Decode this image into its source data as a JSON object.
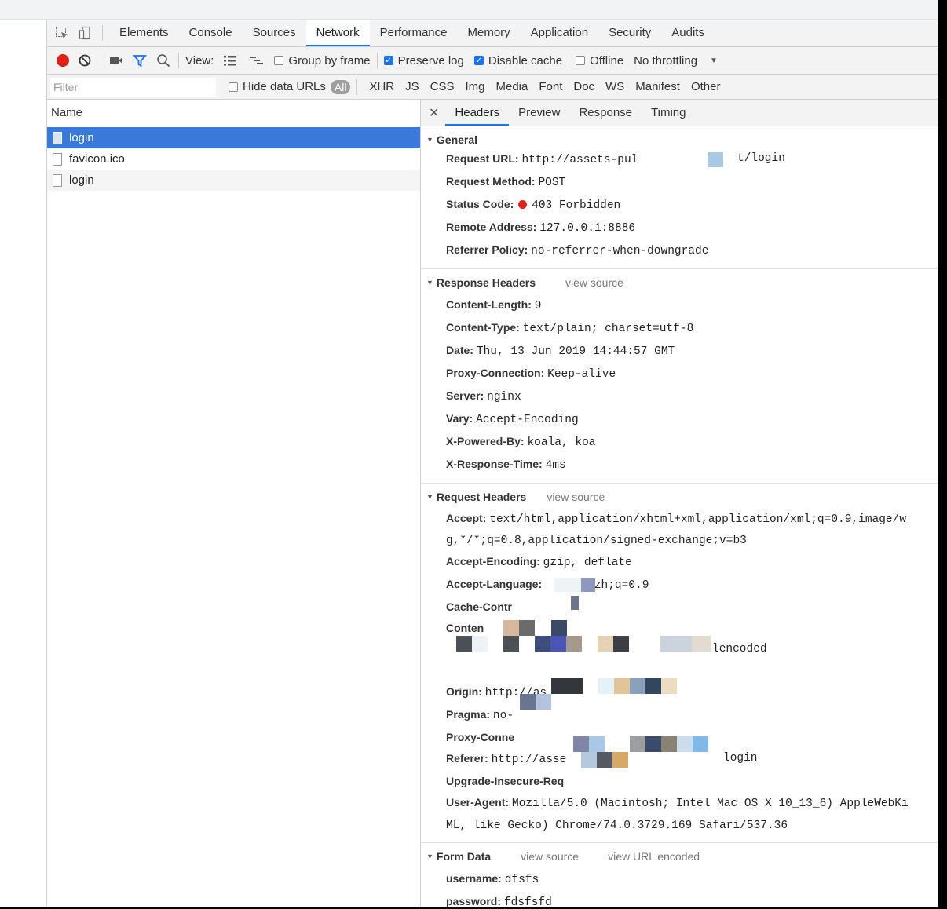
{
  "tabs": [
    "Elements",
    "Console",
    "Sources",
    "Network",
    "Performance",
    "Memory",
    "Application",
    "Security",
    "Audits"
  ],
  "active_tab": "Network",
  "toolbar": {
    "view_label": "View:",
    "group_by_frame": "Group by frame",
    "preserve_log": "Preserve log",
    "disable_cache": "Disable cache",
    "offline": "Offline",
    "throttling": "No throttling"
  },
  "filter": {
    "placeholder": "Filter",
    "hide_data_urls": "Hide data URLs",
    "all": "All",
    "types": [
      "XHR",
      "JS",
      "CSS",
      "Img",
      "Media",
      "Font",
      "Doc",
      "WS",
      "Manifest",
      "Other"
    ]
  },
  "request_list": {
    "header": "Name",
    "items": [
      "login",
      "favicon.ico",
      "login"
    ]
  },
  "detail_tabs": [
    "Headers",
    "Preview",
    "Response",
    "Timing"
  ],
  "general": {
    "title": "General",
    "rows": [
      {
        "k": "Request URL:",
        "v": "http://assets-pul"
      },
      {
        "k": "Request Method:",
        "v": "POST"
      },
      {
        "k": "Status Code:",
        "v": "403 Forbidden"
      },
      {
        "k": "Remote Address:",
        "v": "127.0.0.1:8886"
      },
      {
        "k": "Referrer Policy:",
        "v": "no-referrer-when-downgrade"
      }
    ],
    "url_tail": "t/login"
  },
  "response_headers": {
    "title": "Response Headers",
    "view_source": "view source",
    "rows": [
      {
        "k": "Content-Length:",
        "v": "9"
      },
      {
        "k": "Content-Type:",
        "v": "text/plain; charset=utf-8"
      },
      {
        "k": "Date:",
        "v": "Thu, 13 Jun 2019 14:44:57 GMT"
      },
      {
        "k": "Proxy-Connection:",
        "v": "Keep-alive"
      },
      {
        "k": "Server:",
        "v": "nginx"
      },
      {
        "k": "Vary:",
        "v": "Accept-Encoding"
      },
      {
        "k": "X-Powered-By:",
        "v": "koala, koa"
      },
      {
        "k": "X-Response-Time:",
        "v": "4ms"
      }
    ]
  },
  "request_headers": {
    "title": "Request Headers",
    "view_source": "view source",
    "accept_k": "Accept:",
    "accept_v1": "text/html,application/xhtml+xml,application/xml;q=0.9,image/w",
    "accept_v2": "g,*/*;q=0.8,application/signed-exchange;v=b3",
    "accept_encoding_k": "Accept-Encoding:",
    "accept_encoding_v": "gzip, deflate",
    "accept_language_k": "Accept-Language:",
    "accept_language_v": ",zh;q=0.9",
    "cache_control_k": "Cache-Contr",
    "content_k": "Conten",
    "content_v_tail": "lencoded",
    "origin_k": "Origin:",
    "origin_v": "http://as",
    "pragma_k": "Pragma:",
    "pragma_v": "no-",
    "proxy_conn_k": "Proxy-Conne",
    "referer_k": "Referer:",
    "referer_v": "http://asse",
    "referer_tail": "login",
    "upgrade_k": "Upgrade-Insecure-Req",
    "ua_k": "User-Agent:",
    "ua_v1": "Mozilla/5.0 (Macintosh; Intel Mac OS X 10_13_6) AppleWebKi",
    "ua_v2": "ML, like Gecko) Chrome/74.0.3729.169 Safari/537.36"
  },
  "form_data": {
    "title": "Form Data",
    "view_source": "view source",
    "view_url_encoded": "view URL encoded",
    "rows": [
      {
        "k": "username:",
        "v": "dfsfs"
      },
      {
        "k": "password:",
        "v": "fdsfsfd"
      }
    ]
  }
}
